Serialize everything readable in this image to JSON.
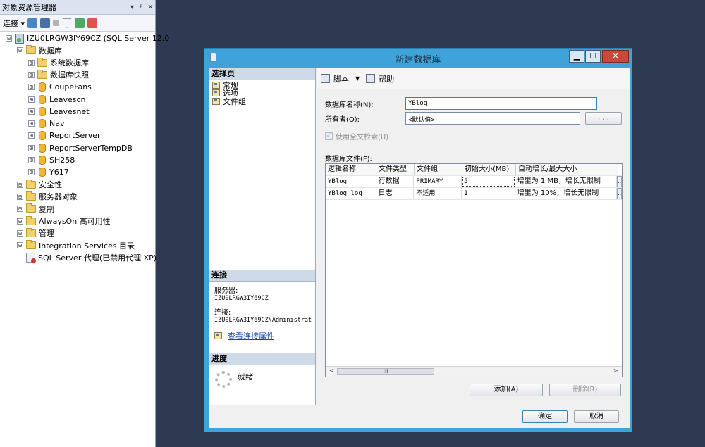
{
  "object_explorer": {
    "title": "对象资源管理器",
    "title_controls": [
      "▾",
      "ᵖ",
      "✕"
    ],
    "connect_label": "连接 ▾",
    "tree": [
      {
        "label": "IZU0LRGW3IY69CZ (SQL Server 12.0",
        "icon": "server-icon",
        "expander": "⊟",
        "level": 0
      },
      {
        "label": "数据库",
        "icon": "folder-icon",
        "expander": "⊟",
        "level": 1
      },
      {
        "label": "系统数据库",
        "icon": "folder-icon",
        "expander": "⊞",
        "level": 2
      },
      {
        "label": "数据库快照",
        "icon": "folder-icon",
        "expander": "⊞",
        "level": 2
      },
      {
        "label": "CoupeFans",
        "icon": "database-icon",
        "expander": "⊞",
        "level": 2
      },
      {
        "label": "Leavescn",
        "icon": "database-icon",
        "expander": "⊞",
        "level": 2
      },
      {
        "label": "Leavesnet",
        "icon": "database-icon",
        "expander": "⊞",
        "level": 2
      },
      {
        "label": "Nav",
        "icon": "database-icon",
        "expander": "⊞",
        "level": 2
      },
      {
        "label": "ReportServer",
        "icon": "database-icon",
        "expander": "⊞",
        "level": 2
      },
      {
        "label": "ReportServerTempDB",
        "icon": "database-icon",
        "expander": "⊞",
        "level": 2
      },
      {
        "label": "SH258",
        "icon": "database-icon",
        "expander": "⊞",
        "level": 2
      },
      {
        "label": "Y617",
        "icon": "database-icon",
        "expander": "⊞",
        "level": 2
      },
      {
        "label": "安全性",
        "icon": "folder-icon",
        "expander": "⊞",
        "level": 1
      },
      {
        "label": "服务器对象",
        "icon": "folder-icon",
        "expander": "⊞",
        "level": 1
      },
      {
        "label": "复制",
        "icon": "folder-icon",
        "expander": "⊞",
        "level": 1
      },
      {
        "label": "AlwaysOn 高可用性",
        "icon": "folder-icon",
        "expander": "⊞",
        "level": 1
      },
      {
        "label": "管理",
        "icon": "folder-icon",
        "expander": "⊞",
        "level": 1
      },
      {
        "label": "Integration Services 目录",
        "icon": "folder-icon",
        "expander": "⊞",
        "level": 1
      },
      {
        "label": "SQL Server 代理(已禁用代理 XP)",
        "icon": "agent-icon",
        "expander": "",
        "level": 1
      }
    ]
  },
  "dialog": {
    "title": "新建数据库",
    "win_buttons": {
      "minimize": "▁",
      "maximize": "☐",
      "close": "✕"
    },
    "select_page": {
      "header": "选择页",
      "pages": [
        "常规",
        "选项",
        "文件组"
      ]
    },
    "connection": {
      "header": "连接",
      "server_label": "服务器:",
      "server_value": "IZU0LRGW3IY69CZ",
      "conn_label": "连接:",
      "conn_value": "IZU0LRGW3IY69CZ\\Administrat",
      "view_link": "查看连接属性"
    },
    "progress": {
      "header": "进度",
      "status": "就绪"
    },
    "toolbar": {
      "script_label": "脚本",
      "script_dropdown": "▼",
      "help_label": "帮助"
    },
    "form": {
      "dbname_label": "数据库名称(N):",
      "dbname_value": "YBlog",
      "owner_label": "所有者(O):",
      "owner_value": "<默认值>",
      "owner_browse": ". . .",
      "fulltext_label": "使用全文检索(U)",
      "fulltext_check": "✓",
      "files_label": "数据库文件(F):"
    },
    "files_grid": {
      "columns": [
        "逻辑名称",
        "文件类型",
        "文件组",
        "初始大小(MB)",
        "自动增长/最大大小"
      ],
      "rows": [
        [
          "YBlog",
          "行数据",
          "PRIMARY",
          "5",
          "增里为 1 MB，增长无限制"
        ],
        [
          "YBlog_log",
          "日志",
          "不适用",
          "1",
          "增里为 10%，增长无限制"
        ]
      ],
      "row_ellipsis": "...",
      "scroll_left": "<",
      "scroll_right": ">",
      "scroll_thumb": "III"
    },
    "grid_buttons": {
      "add": "添加(A)",
      "remove": "删除(R)"
    },
    "footer": {
      "ok": "确定",
      "cancel": "取消"
    }
  }
}
